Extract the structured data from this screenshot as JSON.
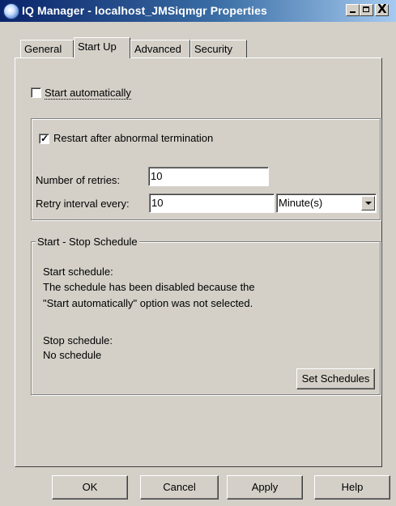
{
  "window": {
    "title": "IQ Manager - localhost_JMSiqmgr Properties",
    "controls": {
      "minimize": "_",
      "maximize": "□",
      "close": "X"
    }
  },
  "tabs": [
    {
      "label": "General"
    },
    {
      "label": "Start Up"
    },
    {
      "label": "Advanced"
    },
    {
      "label": "Security"
    }
  ],
  "active_tab": "Start Up",
  "startup": {
    "start_automatically": {
      "label": "Start automatically",
      "checked": false
    },
    "restart": {
      "label": "Restart after abnormal termination",
      "checked": true,
      "check_glyph": "✓",
      "retries_label": "Number of retries:",
      "retries_value": "10",
      "interval_label": "Retry interval every:",
      "interval_value": "10",
      "interval_unit": "Minute(s)"
    },
    "schedule": {
      "group_title": "Start - Stop Schedule",
      "start_label": "Start schedule:",
      "start_text_1": "The schedule has been disabled because the",
      "start_text_2": "\"Start automatically\" option was not selected.",
      "stop_label": "Stop schedule:",
      "stop_text": "No schedule",
      "set_button": "Set Schedules"
    }
  },
  "footer": {
    "ok": "OK",
    "cancel": "Cancel",
    "apply": "Apply",
    "help": "Help"
  }
}
